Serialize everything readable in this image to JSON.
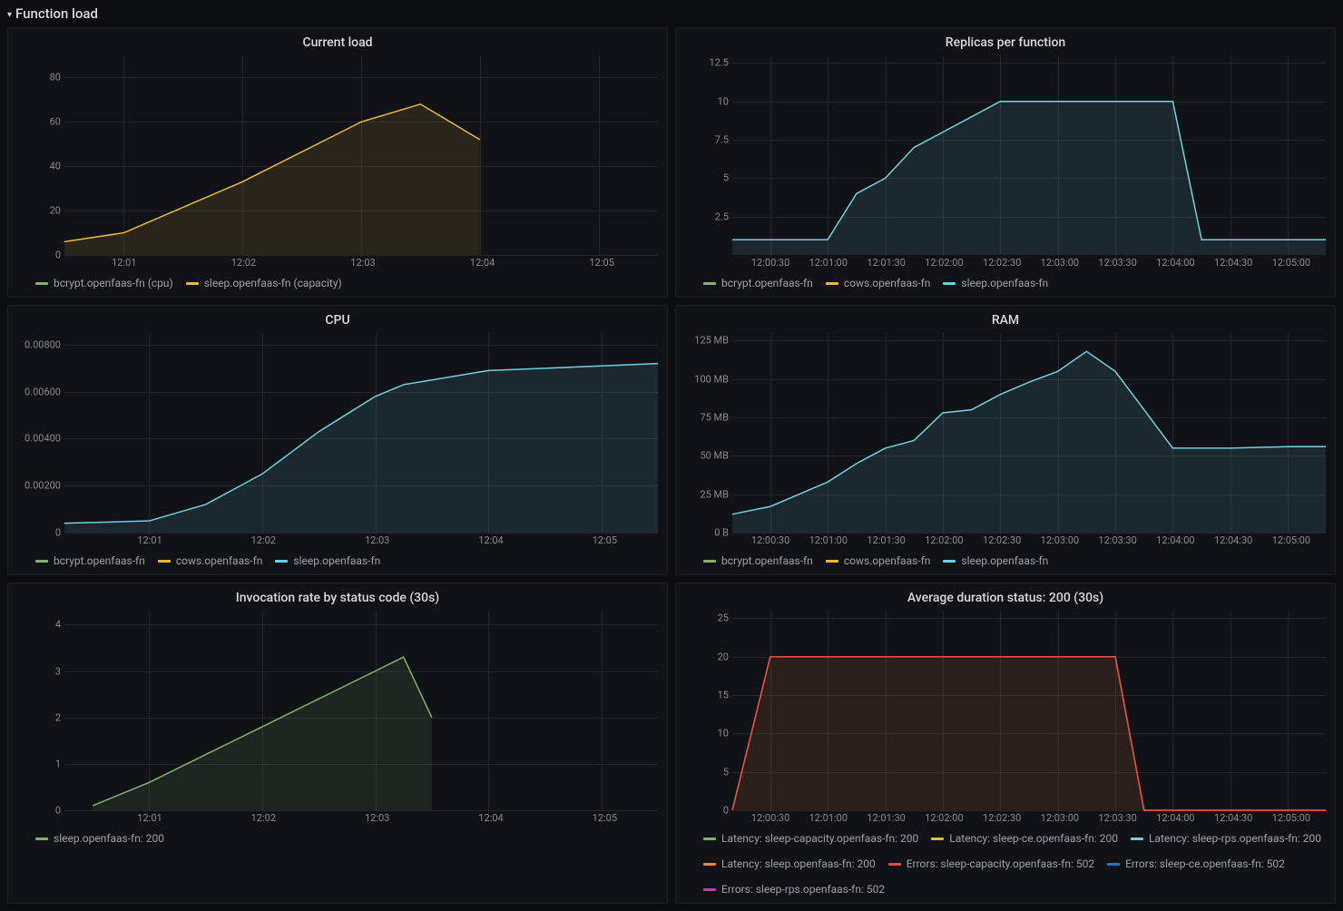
{
  "section_title": "Function load",
  "colors": {
    "green": "#7eb26d",
    "yellow": "#eab839",
    "teal": "#6ed0e0",
    "orange": "#ef843c",
    "red": "#e24d42",
    "blue": "#1f78c1",
    "pink": "#ba43a9"
  },
  "panels": [
    {
      "id": "current_load",
      "title": "Current load",
      "legend": [
        {
          "label": "bcrypt.openfaas-fn (cpu)",
          "color": "green"
        },
        {
          "label": "sleep.openfaas-fn (capacity)",
          "color": "yellow"
        }
      ]
    },
    {
      "id": "replicas",
      "title": "Replicas per function",
      "legend": [
        {
          "label": "bcrypt.openfaas-fn",
          "color": "green"
        },
        {
          "label": "cows.openfaas-fn",
          "color": "yellow"
        },
        {
          "label": "sleep.openfaas-fn",
          "color": "teal"
        }
      ]
    },
    {
      "id": "cpu",
      "title": "CPU",
      "legend": [
        {
          "label": "bcrypt.openfaas-fn",
          "color": "green"
        },
        {
          "label": "cows.openfaas-fn",
          "color": "yellow"
        },
        {
          "label": "sleep.openfaas-fn",
          "color": "teal"
        }
      ]
    },
    {
      "id": "ram",
      "title": "RAM",
      "legend": [
        {
          "label": "bcrypt.openfaas-fn",
          "color": "green"
        },
        {
          "label": "cows.openfaas-fn",
          "color": "yellow"
        },
        {
          "label": "sleep.openfaas-fn",
          "color": "teal"
        }
      ]
    },
    {
      "id": "invocation_rate",
      "title": "Invocation rate by status code (30s)",
      "legend": [
        {
          "label": "sleep.openfaas-fn: 200",
          "color": "green"
        }
      ]
    },
    {
      "id": "avg_duration",
      "title": "Average duration status: 200 (30s)",
      "legend": [
        {
          "label": "Latency: sleep-capacity.openfaas-fn: 200",
          "color": "green"
        },
        {
          "label": "Latency: sleep-ce.openfaas-fn: 200",
          "color": "yellow"
        },
        {
          "label": "Latency: sleep-rps.openfaas-fn: 200",
          "color": "teal"
        },
        {
          "label": "Latency: sleep.openfaas-fn: 200",
          "color": "orange"
        },
        {
          "label": "Errors: sleep-capacity.openfaas-fn: 502",
          "color": "red"
        },
        {
          "label": "Errors: sleep-ce.openfaas-fn: 502",
          "color": "blue"
        },
        {
          "label": "Errors: sleep-rps.openfaas-fn: 502",
          "color": "pink"
        }
      ]
    }
  ],
  "chart_data": [
    {
      "id": "current_load",
      "type": "area",
      "title": "Current load",
      "xlabel": "",
      "ylabel": "",
      "x_ticks": [
        "12:01",
        "12:02",
        "12:03",
        "12:04",
        "12:05"
      ],
      "y_ticks": [
        0,
        20,
        40,
        60,
        80
      ],
      "x_range_minutes": [
        0.5,
        5.5
      ],
      "ylim": [
        0,
        90
      ],
      "series": [
        {
          "name": "sleep.openfaas-fn (capacity)",
          "color": "yellow",
          "x": [
            0.5,
            1.0,
            2.0,
            3.0,
            3.5,
            4.0
          ],
          "values": [
            6,
            10,
            33,
            60,
            68,
            52
          ],
          "fill": true
        }
      ]
    },
    {
      "id": "replicas",
      "type": "area",
      "title": "Replicas per function",
      "xlabel": "",
      "ylabel": "",
      "x_ticks": [
        "12:00:30",
        "12:01:00",
        "12:01:30",
        "12:02:00",
        "12:02:30",
        "12:03:00",
        "12:03:30",
        "12:04:00",
        "12:04:30",
        "12:05:00"
      ],
      "y_ticks": [
        2.5,
        5,
        7.5,
        10,
        12.5
      ],
      "x_range_minutes": [
        0.17,
        5.33
      ],
      "ylim": [
        0,
        13
      ],
      "series": [
        {
          "name": "sleep.openfaas-fn",
          "color": "teal",
          "x": [
            0.17,
            1.0,
            1.25,
            1.5,
            1.75,
            2.0,
            2.25,
            2.5,
            3.0,
            3.5,
            4.0,
            4.25,
            4.5,
            5.0,
            5.33
          ],
          "values": [
            1,
            1,
            4,
            5,
            7,
            8,
            9,
            10,
            10,
            10,
            10,
            1,
            1,
            1,
            1
          ],
          "fill": true
        }
      ]
    },
    {
      "id": "cpu",
      "type": "area",
      "title": "CPU",
      "xlabel": "",
      "ylabel": "",
      "x_ticks": [
        "12:01",
        "12:02",
        "12:03",
        "12:04",
        "12:05"
      ],
      "y_ticks": [
        "0",
        "0.00200",
        "0.00400",
        "0.00600",
        "0.00800"
      ],
      "x_range_minutes": [
        0.25,
        5.5
      ],
      "ylim": [
        0,
        0.0085
      ],
      "series": [
        {
          "name": "sleep.openfaas-fn",
          "color": "teal",
          "x": [
            0.25,
            1.0,
            1.5,
            2.0,
            2.5,
            3.0,
            3.25,
            3.5,
            4.0,
            4.5,
            5.0,
            5.5
          ],
          "values": [
            0.0004,
            0.0005,
            0.0012,
            0.0025,
            0.0043,
            0.0058,
            0.0063,
            0.0065,
            0.0069,
            0.007,
            0.0071,
            0.0072
          ],
          "fill": true
        }
      ]
    },
    {
      "id": "ram",
      "type": "area",
      "title": "RAM",
      "xlabel": "",
      "ylabel": "",
      "x_ticks": [
        "12:00:30",
        "12:01:00",
        "12:01:30",
        "12:02:00",
        "12:02:30",
        "12:03:00",
        "12:03:30",
        "12:04:00",
        "12:04:30",
        "12:05:00"
      ],
      "y_ticks": [
        "0 B",
        "25 MB",
        "50 MB",
        "75 MB",
        "100 MB",
        "125 MB"
      ],
      "x_range_minutes": [
        0.17,
        5.33
      ],
      "ylim": [
        0,
        130
      ],
      "series": [
        {
          "name": "sleep.openfaas-fn",
          "color": "teal",
          "x": [
            0.17,
            0.5,
            1.0,
            1.25,
            1.5,
            1.75,
            2.0,
            2.25,
            2.5,
            2.75,
            3.0,
            3.25,
            3.5,
            4.0,
            4.5,
            5.0,
            5.33
          ],
          "values": [
            12,
            17,
            33,
            45,
            55,
            60,
            78,
            80,
            90,
            98,
            105,
            118,
            105,
            55,
            55,
            56,
            56
          ],
          "fill": true
        }
      ]
    },
    {
      "id": "invocation_rate",
      "type": "area",
      "title": "Invocation rate by status code (30s)",
      "xlabel": "",
      "ylabel": "",
      "x_ticks": [
        "12:01",
        "12:02",
        "12:03",
        "12:04",
        "12:05"
      ],
      "y_ticks": [
        0,
        1,
        2,
        3,
        4
      ],
      "x_range_minutes": [
        0.25,
        5.5
      ],
      "ylim": [
        0,
        4.3
      ],
      "series": [
        {
          "name": "sleep.openfaas-fn: 200",
          "color": "green",
          "x": [
            0.5,
            1.0,
            1.5,
            2.0,
            2.5,
            3.0,
            3.25,
            3.5
          ],
          "values": [
            0.1,
            0.6,
            1.2,
            1.8,
            2.4,
            3.0,
            3.3,
            2.0
          ],
          "fill": true
        }
      ]
    },
    {
      "id": "avg_duration",
      "type": "area",
      "title": "Average duration status: 200 (30s)",
      "xlabel": "",
      "ylabel": "",
      "x_ticks": [
        "12:00:30",
        "12:01:00",
        "12:01:30",
        "12:02:00",
        "12:02:30",
        "12:03:00",
        "12:03:30",
        "12:04:00",
        "12:04:30",
        "12:05:00"
      ],
      "y_ticks": [
        0,
        5,
        10,
        15,
        20,
        25
      ],
      "x_range_minutes": [
        0.17,
        5.33
      ],
      "ylim": [
        0,
        26
      ],
      "series": [
        {
          "name": "Latency: sleep.openfaas-fn: 200",
          "color": "orange",
          "x": [
            0.17,
            0.5,
            3.5,
            3.75,
            5.33
          ],
          "values": [
            0,
            20,
            20,
            0,
            0
          ],
          "fill": true
        },
        {
          "name": "Errors: sleep-capacity.openfaas-fn: 502",
          "color": "red",
          "x": [
            0.17,
            0.5,
            3.5,
            3.75,
            5.33
          ],
          "values": [
            0,
            20,
            20,
            0,
            0
          ],
          "fill": false
        }
      ]
    }
  ]
}
